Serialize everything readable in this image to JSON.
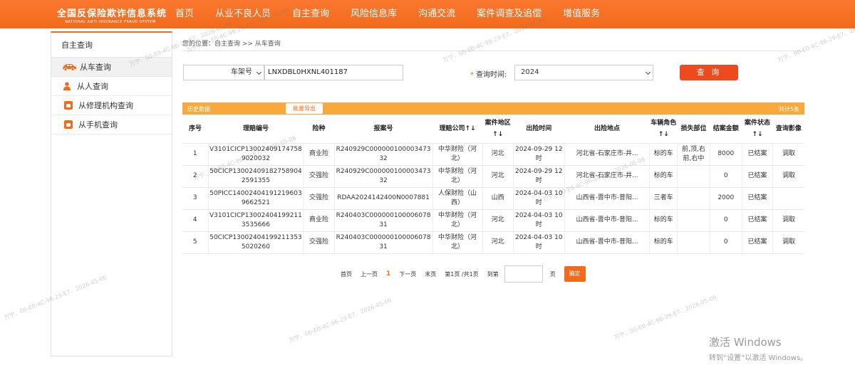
{
  "header": {
    "logo_cn": "全国反保险欺诈信息系统",
    "logo_en": "NATIONAL ANTI INSURANCE FRAUD SYSTEM",
    "nav": [
      "首页",
      "从业不良人员",
      "自主查询",
      "风险信息库",
      "沟通交流",
      "案件调查及追偿",
      "增值服务"
    ]
  },
  "sidebar": {
    "title": "自主查询",
    "items": [
      {
        "label": "从车查询",
        "icon": "car-icon"
      },
      {
        "label": "从人查询",
        "icon": "person-icon"
      },
      {
        "label": "从修理机构查询",
        "icon": "repair-shop-icon"
      },
      {
        "label": "从手机查询",
        "icon": "phone-icon"
      }
    ]
  },
  "breadcrumb": "您的位置：自主查询 >> 从车查询",
  "search": {
    "type_selected": "车架号",
    "vin_value": "LNXDBL0HXNL401187",
    "time_label": "查询时间:",
    "year_selected": "2024",
    "query_button": "查 询"
  },
  "table_bar": {
    "history_label": "历史数据",
    "batch_export": "批量导出",
    "total": "共计5条"
  },
  "table": {
    "headers": [
      "序号",
      "理赔编号",
      "险种",
      "报案号",
      "理赔公司↑↓",
      "案件地区↑↓",
      "出险时间",
      "出险地点",
      "车辆角色↑↓",
      "损失部位",
      "结案金额",
      "案件状态↑↓",
      "查询影像"
    ],
    "rows": [
      {
        "no": "1",
        "claim": "V3101CICP130024091747589020032",
        "ins": "商业险",
        "report": "R240929C00000010000347332",
        "company": "中华财险（河北）",
        "region": "河北",
        "time": "2024-09-29 12时",
        "place": "河北省-石家庄市-井...",
        "role": "标的车",
        "damage": "前,顶,右前,右中",
        "amount": "8000",
        "status": "已结案",
        "image": "调取"
      },
      {
        "no": "2",
        "claim": "50CICP130024091827589042591355",
        "ins": "交强险",
        "report": "R240929C00000010000347332",
        "company": "中华财险（河北）",
        "region": "河北",
        "time": "2024-09-29 12时",
        "place": "河北省-石家庄市-井...",
        "role": "标的车",
        "damage": "",
        "amount": "0",
        "status": "已结案",
        "image": "调取"
      },
      {
        "no": "3",
        "claim": "50PICC140024041912196039662521",
        "ins": "交强险",
        "report": "RDAA2024142400N0007881",
        "company": "人保财险（山西）",
        "region": "山西",
        "time": "2024-04-03 10时",
        "place": "山西省-晋中市-昔阳...",
        "role": "三者车",
        "damage": "",
        "amount": "2000",
        "status": "已结案",
        "image": ""
      },
      {
        "no": "4",
        "claim": "V3101CICP130024041992113535666",
        "ins": "商业险",
        "report": "R240403C00000010000607831",
        "company": "中华财险（河北）",
        "region": "河北",
        "time": "2024-04-03 10时",
        "place": "山西省-晋中市-昔阳...",
        "role": "标的车",
        "damage": "",
        "amount": "0",
        "status": "已结案",
        "image": "调取"
      },
      {
        "no": "5",
        "claim": "50CICP130024041992113535020260",
        "ins": "交强险",
        "report": "R240403C00000010000607831",
        "company": "中华财险（河北）",
        "region": "河北",
        "time": "2024-04-03 10时",
        "place": "山西省-晋中市-昔阳...",
        "role": "标的车",
        "damage": "",
        "amount": "0",
        "status": "已结案",
        "image": "调取"
      }
    ]
  },
  "pager": {
    "first": "首页",
    "prev": "上一页",
    "current": "1",
    "next": "下一页",
    "last": "末页",
    "info": "第1页 /共1页",
    "goto": "到第",
    "page_unit": "页",
    "confirm": "确定"
  },
  "watermark": "万宁、00-E0-4C-96-29-E7、2026-05-06",
  "windows": {
    "line1": "激活 Windows",
    "line2": "转到“设置”以激活 Windows。"
  },
  "colors": {
    "brand": "#f26a1b",
    "bar": "#f9a93b",
    "query_btn": "#ed4b1d"
  }
}
